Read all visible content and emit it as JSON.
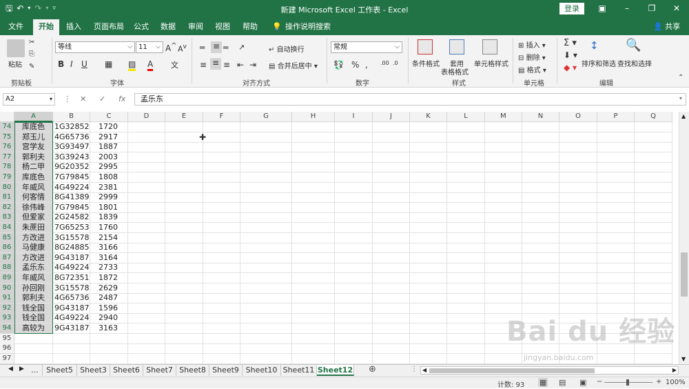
{
  "window": {
    "title": "新建 Microsoft Excel 工作表 - Excel",
    "login": "登录",
    "share": "共享"
  },
  "ribbon_tabs": [
    "文件",
    "开始",
    "插入",
    "页面布局",
    "公式",
    "数据",
    "审阅",
    "视图",
    "帮助",
    "操作说明搜索"
  ],
  "ribbon": {
    "paste": "粘贴",
    "clipboard": "剪贴板",
    "font_name": "等线",
    "font_size": "11",
    "font_group": "字体",
    "wrap_text": "自动换行",
    "merge_center": "合并后居中",
    "align_group": "对齐方式",
    "number_format": "常规",
    "number_group": "数字",
    "cond_format": "条件格式",
    "table_format_1": "套用",
    "table_format_2": "表格格式",
    "cell_style": "单元格样式",
    "styles_group": "样式",
    "insert": "插入",
    "delete": "删除",
    "format": "格式",
    "cells_group": "单元格",
    "sort_filter": "排序和筛选",
    "find_select": "查找和选择",
    "edit_group": "编辑"
  },
  "formula_bar": {
    "name_box": "A2",
    "fx": "fx",
    "value": "孟乐东"
  },
  "columns": [
    "A",
    "B",
    "C",
    "D",
    "E",
    "F",
    "G",
    "H",
    "I",
    "J",
    "K",
    "L",
    "M",
    "N",
    "O",
    "P",
    "Q"
  ],
  "rows": [
    {
      "n": "74",
      "a": "库底色",
      "b": "1G32852",
      "c": "1720"
    },
    {
      "n": "75",
      "a": "郑玉儿",
      "b": "4G65736",
      "c": "2917"
    },
    {
      "n": "76",
      "a": "宫学友",
      "b": "3G93497",
      "c": "1887"
    },
    {
      "n": "77",
      "a": "郭利夫",
      "b": "3G39243",
      "c": "2003"
    },
    {
      "n": "78",
      "a": "杨二甲",
      "b": "9G20352",
      "c": "2995"
    },
    {
      "n": "79",
      "a": "库底色",
      "b": "7G79845",
      "c": "1808"
    },
    {
      "n": "80",
      "a": "年威风",
      "b": "4G49224",
      "c": "2381"
    },
    {
      "n": "81",
      "a": "何客情",
      "b": "8G41389",
      "c": "2999"
    },
    {
      "n": "82",
      "a": "徐伟峰",
      "b": "7G79845",
      "c": "1801"
    },
    {
      "n": "83",
      "a": "但爱家",
      "b": "2G24582",
      "c": "1839"
    },
    {
      "n": "84",
      "a": "朱蔗田",
      "b": "7G65253",
      "c": "1760"
    },
    {
      "n": "85",
      "a": "方改进",
      "b": "3G15578",
      "c": "2154"
    },
    {
      "n": "86",
      "a": "马健康",
      "b": "8G24885",
      "c": "3166"
    },
    {
      "n": "87",
      "a": "方改进",
      "b": "9G43187",
      "c": "3164"
    },
    {
      "n": "88",
      "a": "孟乐东",
      "b": "4G49224",
      "c": "2733"
    },
    {
      "n": "89",
      "a": "年威风",
      "b": "8G72351",
      "c": "1872"
    },
    {
      "n": "90",
      "a": "孙回刚",
      "b": "3G15578",
      "c": "2629"
    },
    {
      "n": "91",
      "a": "郭利夫",
      "b": "4G65736",
      "c": "2487"
    },
    {
      "n": "92",
      "a": "钱全国",
      "b": "9G43187",
      "c": "1596"
    },
    {
      "n": "93",
      "a": "钱全国",
      "b": "4G49224",
      "c": "2940"
    },
    {
      "n": "94",
      "a": "高较为",
      "b": "9G43187",
      "c": "3163"
    },
    {
      "n": "95",
      "a": "",
      "b": "",
      "c": ""
    },
    {
      "n": "96",
      "a": "",
      "b": "",
      "c": ""
    },
    {
      "n": "97",
      "a": "",
      "b": "",
      "c": ""
    }
  ],
  "sheets": [
    "...",
    "Sheet5",
    "Sheet3",
    "Sheet6",
    "Sheet7",
    "Sheet8",
    "Sheet9",
    "Sheet10",
    "Sheet11",
    "Sheet12"
  ],
  "active_sheet": "Sheet12",
  "status": {
    "count": "计数: 93",
    "zoom": "100%"
  },
  "watermark": {
    "main": "Bai du 经验",
    "sub": "jingyan.baidu.com"
  },
  "colors": {
    "accent": "#217346",
    "selected_col": "#d9d9d9"
  }
}
